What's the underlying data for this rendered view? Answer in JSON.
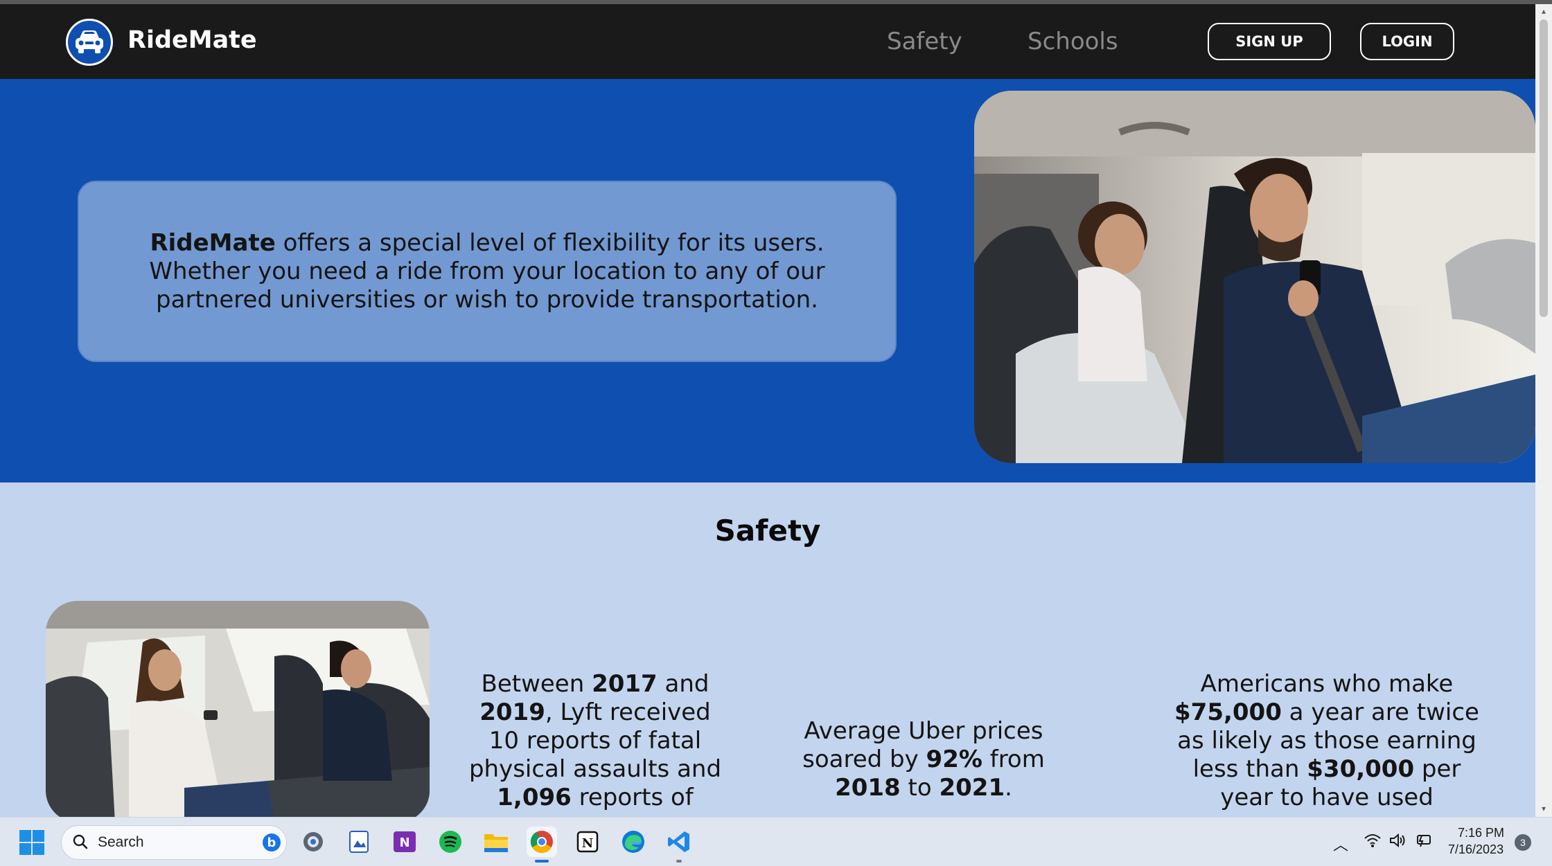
{
  "nav": {
    "brand": "RideMate",
    "links": [
      "Safety",
      "Schools"
    ],
    "signup_label": "SIGN UP",
    "login_label": "LOGIN"
  },
  "hero": {
    "brand_bold": "RideMate",
    "text": " offers a special level of flexibility for its users. Whether you need a ride from your location to any of our partnered universities or wish to provide transportation."
  },
  "safety": {
    "title": "Safety",
    "stat1": {
      "p1": "Between ",
      "b1": "2017",
      "p2": " and ",
      "b2": "2019",
      "p3": ", Lyft received 10 reports of fatal physical assaults and ",
      "b3": "1,096",
      "p4": " reports of"
    },
    "stat2": {
      "p1": "Average Uber prices soared by ",
      "b1": "92%",
      "p2": " from ",
      "b2": "2018",
      "p3": " to ",
      "b3": "2021",
      "p4": "."
    },
    "stat3": {
      "p1": "Americans who make ",
      "b1": "$75,000",
      "p2": " a year are twice as likely as those earning less than ",
      "b2": "$30,000",
      "p3": " per year to have used"
    }
  },
  "taskbar": {
    "search_label": "Search",
    "bing_badge": "b",
    "time": "7:16 PM",
    "date": "7/16/2023",
    "notifications": "3",
    "apps": [
      "settings-icon",
      "photos-icon",
      "onenote-icon",
      "spotify-icon",
      "file-explorer-icon",
      "chrome-icon",
      "notion-icon",
      "edge-icon",
      "vscode-icon"
    ]
  }
}
